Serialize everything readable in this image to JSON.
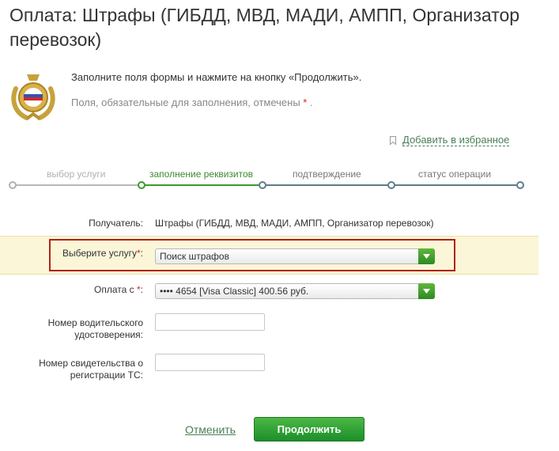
{
  "page": {
    "title": "Оплата: Штрафы (ГИБДД, МВД, МАДИ, АМПП, Организатор перевозок)"
  },
  "intro": {
    "instruction": "Заполните поля формы и нажмите на кнопку «Продолжить».",
    "required_note": "Поля, обязательные для заполнения, отмечены",
    "required_mark": "*",
    "period": "."
  },
  "favorites": {
    "label": "Добавить в избранное",
    "icon": "bookmark-icon"
  },
  "steps": [
    {
      "label": "выбор услуги",
      "state": "done"
    },
    {
      "label": "заполнение реквизитов",
      "state": "active"
    },
    {
      "label": "подтверждение",
      "state": "pending"
    },
    {
      "label": "статус операции",
      "state": "pending"
    }
  ],
  "form": {
    "recipient_label": "Получатель:",
    "recipient_value": "Штрафы (ГИБДД, МВД, МАДИ, АМПП, Организатор перевозок)",
    "service_label": "Выберите услугу",
    "service_value": "Поиск штрафов",
    "payfrom_label": "Оплата с",
    "payfrom_value": "•••• 4654 [Visa Classic] 400.56 руб.",
    "license_label_1": "Номер водительского",
    "license_label_2": "удостоверения:",
    "license_value": "",
    "vehicle_label_1": "Номер свидетельства о",
    "vehicle_label_2": "регистрации ТС:",
    "vehicle_value": "",
    "required_mark": "*",
    "colon": ":"
  },
  "actions": {
    "cancel": "Отменить",
    "continue": "Продолжить"
  },
  "colors": {
    "accent_green": "#2d8a23",
    "required_red": "#e02020",
    "highlight_border": "#b0231b"
  }
}
